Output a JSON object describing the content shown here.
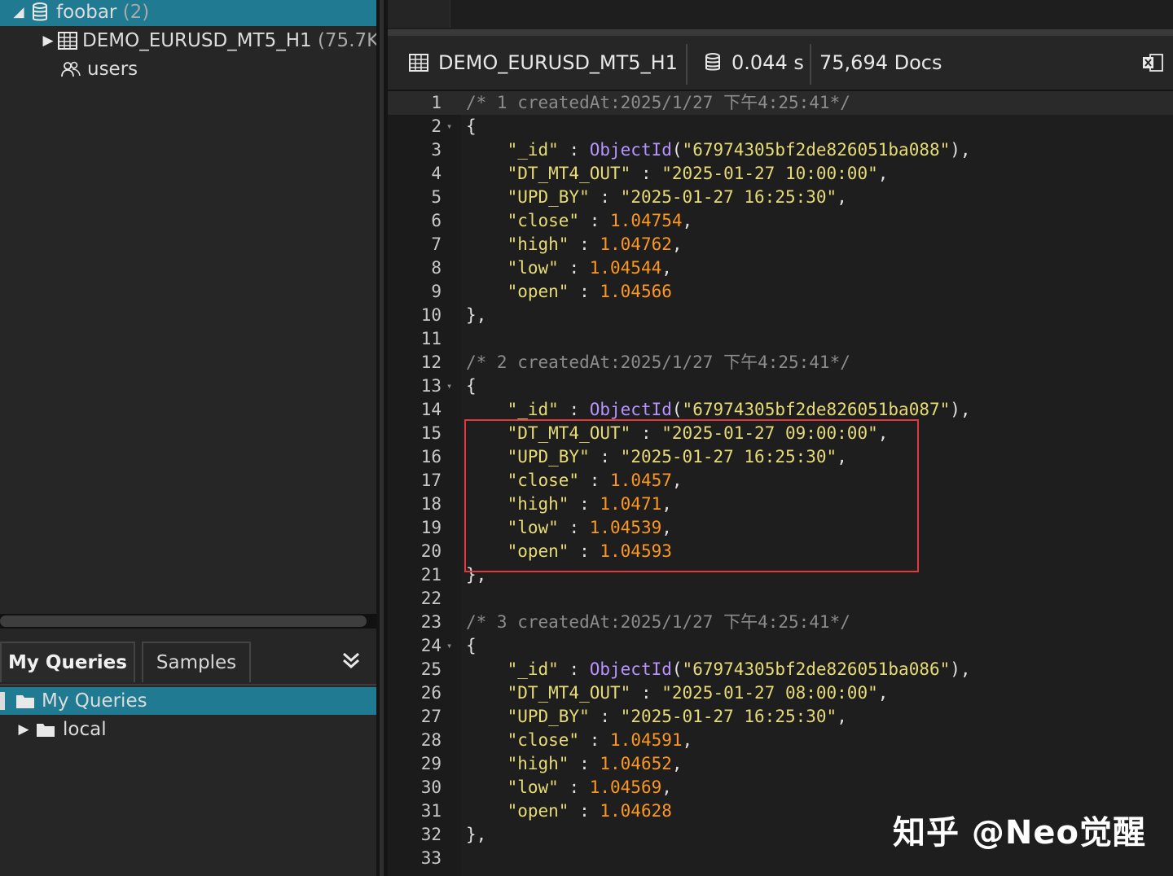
{
  "tree": {
    "db": {
      "name": "foobar",
      "count": "(2)"
    },
    "items": [
      {
        "label": "DEMO_EURUSD_MT5_H1",
        "meta": "(75.7K"
      },
      {
        "label": "users",
        "meta": ""
      }
    ]
  },
  "queries": {
    "tabs": [
      "My Queries",
      "Samples"
    ],
    "folders": [
      {
        "label": "My Queries"
      },
      {
        "label": "local"
      }
    ]
  },
  "result_header": {
    "collection": "DEMO_EURUSD_MT5_H1",
    "time": "0.044 s",
    "docs": "75,694 Docs"
  },
  "documents": [
    {
      "comment": "/* 1 createdAt:2025/1/27 下午4:25:41*/",
      "id": "67974305bf2de826051ba088",
      "dt_mt4_out": "2025-01-27 10:00:00",
      "upd_by": "2025-01-27 16:25:30",
      "close": "1.04754",
      "high": "1.04762",
      "low": "1.04544",
      "open": "1.04566"
    },
    {
      "comment": "/* 2 createdAt:2025/1/27 下午4:25:41*/",
      "id": "67974305bf2de826051ba087",
      "dt_mt4_out": "2025-01-27 09:00:00",
      "upd_by": "2025-01-27 16:25:30",
      "close": "1.0457",
      "high": "1.0471",
      "low": "1.04539",
      "open": "1.04593"
    },
    {
      "comment": "/* 3 createdAt:2025/1/27 下午4:25:41*/",
      "id": "67974305bf2de826051ba086",
      "dt_mt4_out": "2025-01-27 08:00:00",
      "upd_by": "2025-01-27 16:25:30",
      "close": "1.04591",
      "high": "1.04652",
      "low": "1.04569",
      "open": "1.04628"
    }
  ],
  "watermark": "知乎 @Neo觉醒",
  "colors": {
    "selection": "#1f7a92",
    "highlight_box": "#e0393e"
  }
}
